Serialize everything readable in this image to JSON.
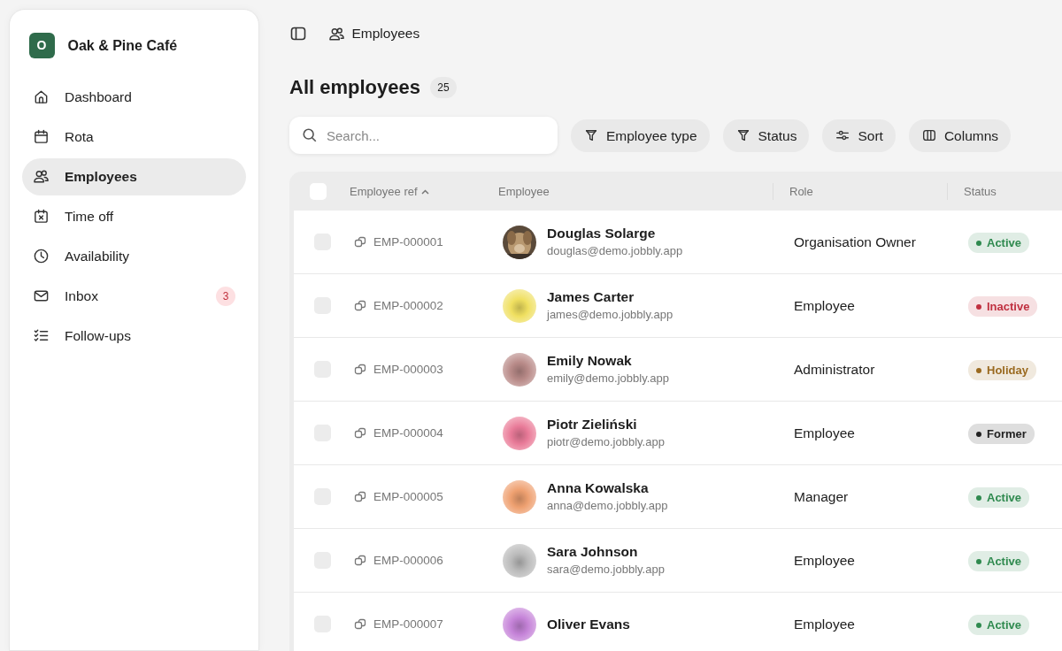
{
  "sidebar": {
    "brand": {
      "initial": "O",
      "name": "Oak & Pine Café"
    },
    "items": [
      {
        "label": "Dashboard",
        "kind": "home",
        "selected": false
      },
      {
        "label": "Rota",
        "kind": "calendar",
        "selected": false
      },
      {
        "label": "Employees",
        "kind": "users",
        "selected": true
      },
      {
        "label": "Time off",
        "kind": "timeoff",
        "selected": false
      },
      {
        "label": "Availability",
        "kind": "clock",
        "selected": false
      },
      {
        "label": "Inbox",
        "kind": "mail",
        "selected": false,
        "badge": "3"
      },
      {
        "label": "Follow-ups",
        "kind": "checklist",
        "selected": false
      }
    ]
  },
  "breadcrumb": "Employees",
  "heading": "All employees",
  "count": "25",
  "search": {
    "placeholder": "Search..."
  },
  "filters": [
    {
      "label": "Employee type",
      "kind": "filter"
    },
    {
      "label": "Status",
      "kind": "filter"
    },
    {
      "label": "Sort",
      "kind": "sort"
    },
    {
      "label": "Columns",
      "kind": "columns"
    }
  ],
  "table": {
    "select_all": {
      "checked": false
    },
    "columns": [
      {
        "label": "Employee ref",
        "sorted": true
      },
      {
        "label": "Employee"
      },
      {
        "label": "Role"
      },
      {
        "label": "Status"
      }
    ],
    "rows": [
      {
        "selected": false,
        "ref": "EMP-000001",
        "name": "Douglas Solarge",
        "email": "douglas@demo.jobbly.app",
        "role": "Organisation Owner",
        "status": {
          "label": "Active",
          "color": "#2f8a4f"
        }
      },
      {
        "selected": false,
        "ref": "EMP-000002",
        "name": "James Carter",
        "email": "james@demo.jobbly.app",
        "avatar": {
          "kind": "blob",
          "color": "#f0e060"
        },
        "role": "Employee",
        "status": {
          "label": "Inactive",
          "color": "#c03040"
        }
      },
      {
        "selected": false,
        "ref": "EMP-000003",
        "name": "Emily Nowak",
        "email": "emily@demo.jobbly.app",
        "avatar": {
          "kind": "blob",
          "color": "#b88a88"
        },
        "role": "Administrator",
        "status": {
          "label": "Holiday",
          "color": "#9a6a20"
        }
      },
      {
        "selected": false,
        "ref": "EMP-000004",
        "name": "Piotr Zieliński",
        "email": "piotr@demo.jobbly.app",
        "avatar": {
          "kind": "blob",
          "color": "#e87a98"
        },
        "role": "Employee",
        "status": {
          "label": "Former",
          "color": "#222222"
        }
      },
      {
        "selected": false,
        "ref": "EMP-000005",
        "name": "Anna Kowalska",
        "email": "anna@demo.jobbly.app",
        "avatar": {
          "kind": "blob",
          "color": "#eea070"
        },
        "role": "Manager",
        "status": {
          "label": "Active",
          "color": "#2f8a4f"
        }
      },
      {
        "selected": false,
        "ref": "EMP-000006",
        "name": "Sara Johnson",
        "email": "sara@demo.jobbly.app",
        "avatar": {
          "kind": "blob",
          "color": "#bbbbbb"
        },
        "role": "Employee",
        "status": {
          "label": "Active",
          "color": "#2f8a4f"
        }
      },
      {
        "selected": false,
        "ref": "EMP-000007",
        "name": "Oliver Evans",
        "avatar": {
          "kind": "blob",
          "color": "#c583d8"
        },
        "role": "Employee",
        "status": {
          "label": "Active",
          "color": "#2f8a4f"
        }
      }
    ]
  }
}
